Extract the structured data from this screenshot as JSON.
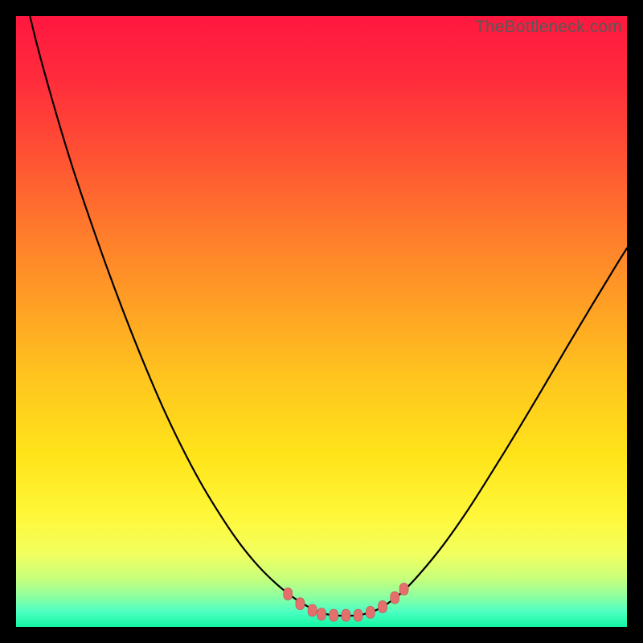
{
  "watermark": "TheBottleneck.com",
  "gradient_stops": [
    {
      "offset": 0.0,
      "color": "#ff173f"
    },
    {
      "offset": 0.1,
      "color": "#ff2b3c"
    },
    {
      "offset": 0.22,
      "color": "#ff4f34"
    },
    {
      "offset": 0.35,
      "color": "#ff7a2c"
    },
    {
      "offset": 0.48,
      "color": "#ffa224"
    },
    {
      "offset": 0.6,
      "color": "#ffc71e"
    },
    {
      "offset": 0.72,
      "color": "#ffe41a"
    },
    {
      "offset": 0.82,
      "color": "#fff83a"
    },
    {
      "offset": 0.88,
      "color": "#f2ff5f"
    },
    {
      "offset": 0.92,
      "color": "#c9ff7a"
    },
    {
      "offset": 0.95,
      "color": "#8effa0"
    },
    {
      "offset": 0.975,
      "color": "#4dffc2"
    },
    {
      "offset": 1.0,
      "color": "#12f7a4"
    }
  ],
  "curve_color": "#000000",
  "curve_width": 2.2,
  "marker_fill": "#e46f6d",
  "marker_stroke": "#bf5652",
  "chart_data": {
    "type": "line",
    "title": "",
    "xlabel": "",
    "ylabel": "",
    "xlim": [
      0,
      100
    ],
    "ylim": [
      0,
      100
    ],
    "grid": false,
    "series": [
      {
        "name": "bottleneck-curve",
        "x": [
          0,
          3,
          6,
          9,
          12,
          15,
          18,
          21,
          24,
          27,
          30,
          33,
          36,
          39,
          42,
          45,
          48,
          50,
          52,
          54,
          56,
          58,
          60,
          63,
          66,
          70,
          74,
          78,
          82,
          86,
          90,
          94,
          98,
          100
        ],
        "y": [
          110,
          97,
          86,
          76,
          67,
          58.5,
          50.5,
          43,
          36,
          29.7,
          24,
          19,
          14.5,
          10.7,
          7.6,
          5.1,
          3.2,
          2.3,
          1.9,
          1.85,
          1.9,
          2.4,
          3.3,
          5.5,
          8.6,
          13.5,
          19.2,
          25.5,
          32,
          38.7,
          45.5,
          52.2,
          58.8,
          62
        ]
      }
    ],
    "markers": {
      "name": "highlight-dots",
      "points": [
        {
          "x": 44.5,
          "y": 5.4
        },
        {
          "x": 46.5,
          "y": 3.8
        },
        {
          "x": 48.5,
          "y": 2.7
        },
        {
          "x": 50.0,
          "y": 2.1
        },
        {
          "x": 52.0,
          "y": 1.9
        },
        {
          "x": 54.0,
          "y": 1.9
        },
        {
          "x": 56.0,
          "y": 1.9
        },
        {
          "x": 58.0,
          "y": 2.4
        },
        {
          "x": 60.0,
          "y": 3.3
        },
        {
          "x": 62.0,
          "y": 4.8
        },
        {
          "x": 63.5,
          "y": 6.2
        }
      ]
    }
  }
}
